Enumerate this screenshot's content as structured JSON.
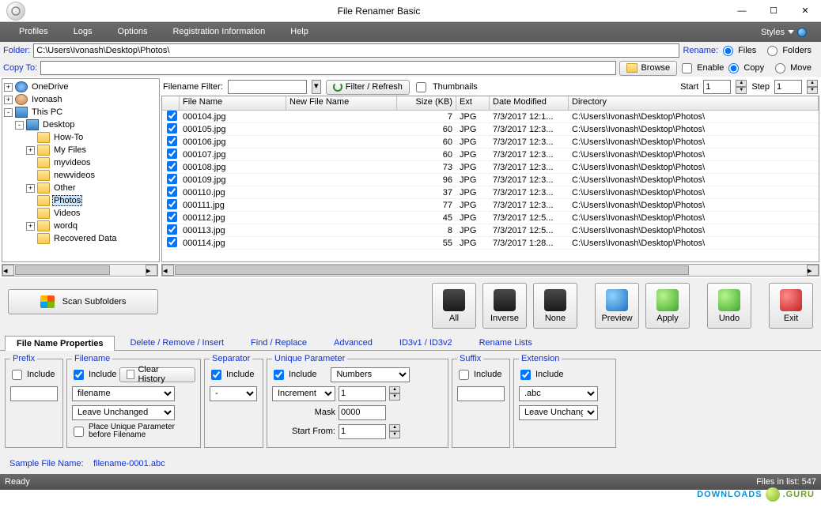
{
  "window": {
    "title": "File Renamer Basic"
  },
  "menu": {
    "items": [
      "Profiles",
      "Logs",
      "Options",
      "Registration Information",
      "Help"
    ],
    "styles": "Styles"
  },
  "toprow": {
    "folder_label": "Folder:",
    "folder_path": "C:\\Users\\Ivonash\\Desktop\\Photos\\",
    "rename_label": "Rename:",
    "files_label": "Files",
    "folders_label": "Folders"
  },
  "copyrow": {
    "copyto_label": "Copy To:",
    "copyto_path": "",
    "browse": "Browse",
    "enable": "Enable",
    "copy": "Copy",
    "move": "Move"
  },
  "tree": {
    "nodes": [
      {
        "exp": "+",
        "ind": 0,
        "icon": "cloud",
        "label": "OneDrive"
      },
      {
        "exp": "+",
        "ind": 0,
        "icon": "avatar",
        "label": "Ivonash"
      },
      {
        "exp": "-",
        "ind": 0,
        "icon": "pc",
        "label": "This PC"
      },
      {
        "exp": "-",
        "ind": 1,
        "icon": "pc",
        "label": "Desktop"
      },
      {
        "exp": "",
        "ind": 2,
        "icon": "folder",
        "label": "How-To"
      },
      {
        "exp": "+",
        "ind": 2,
        "icon": "folder",
        "label": "My Files"
      },
      {
        "exp": "",
        "ind": 2,
        "icon": "folder",
        "label": "myvideos"
      },
      {
        "exp": "",
        "ind": 2,
        "icon": "folder",
        "label": "newvideos"
      },
      {
        "exp": "+",
        "ind": 2,
        "icon": "folder",
        "label": "Other"
      },
      {
        "exp": "",
        "ind": 2,
        "icon": "folder",
        "label": "Photos",
        "sel": true
      },
      {
        "exp": "",
        "ind": 2,
        "icon": "folder",
        "label": "Videos"
      },
      {
        "exp": "+",
        "ind": 2,
        "icon": "folder",
        "label": "wordq"
      },
      {
        "exp": "",
        "ind": 2,
        "icon": "folder",
        "label": "Recovered Data"
      }
    ]
  },
  "filter": {
    "label": "Filename Filter:",
    "filter_refresh": "Filter / Refresh",
    "thumbnails": "Thumbnails",
    "start_label": "Start",
    "start_value": "1",
    "step_label": "Step",
    "step_value": "1"
  },
  "grid": {
    "headers": [
      "",
      "File Name",
      "New File Name",
      "Size (KB)",
      "Ext",
      "Date Modified",
      "Directory"
    ],
    "rows": [
      {
        "name": "000104.jpg",
        "new": "",
        "size": "7",
        "ext": "JPG",
        "date": "7/3/2017 12:1...",
        "dir": "C:\\Users\\Ivonash\\Desktop\\Photos\\"
      },
      {
        "name": "000105.jpg",
        "new": "",
        "size": "60",
        "ext": "JPG",
        "date": "7/3/2017 12:3...",
        "dir": "C:\\Users\\Ivonash\\Desktop\\Photos\\"
      },
      {
        "name": "000106.jpg",
        "new": "",
        "size": "60",
        "ext": "JPG",
        "date": "7/3/2017 12:3...",
        "dir": "C:\\Users\\Ivonash\\Desktop\\Photos\\"
      },
      {
        "name": "000107.jpg",
        "new": "",
        "size": "60",
        "ext": "JPG",
        "date": "7/3/2017 12:3...",
        "dir": "C:\\Users\\Ivonash\\Desktop\\Photos\\"
      },
      {
        "name": "000108.jpg",
        "new": "",
        "size": "73",
        "ext": "JPG",
        "date": "7/3/2017 12:3...",
        "dir": "C:\\Users\\Ivonash\\Desktop\\Photos\\"
      },
      {
        "name": "000109.jpg",
        "new": "",
        "size": "96",
        "ext": "JPG",
        "date": "7/3/2017 12:3...",
        "dir": "C:\\Users\\Ivonash\\Desktop\\Photos\\"
      },
      {
        "name": "000110.jpg",
        "new": "",
        "size": "37",
        "ext": "JPG",
        "date": "7/3/2017 12:3...",
        "dir": "C:\\Users\\Ivonash\\Desktop\\Photos\\"
      },
      {
        "name": "000111.jpg",
        "new": "",
        "size": "77",
        "ext": "JPG",
        "date": "7/3/2017 12:3...",
        "dir": "C:\\Users\\Ivonash\\Desktop\\Photos\\"
      },
      {
        "name": "000112.jpg",
        "new": "",
        "size": "45",
        "ext": "JPG",
        "date": "7/3/2017 12:5...",
        "dir": "C:\\Users\\Ivonash\\Desktop\\Photos\\"
      },
      {
        "name": "000113.jpg",
        "new": "",
        "size": "8",
        "ext": "JPG",
        "date": "7/3/2017 12:5...",
        "dir": "C:\\Users\\Ivonash\\Desktop\\Photos\\"
      },
      {
        "name": "000114.jpg",
        "new": "",
        "size": "55",
        "ext": "JPG",
        "date": "7/3/2017 1:28...",
        "dir": "C:\\Users\\Ivonash\\Desktop\\Photos\\"
      }
    ]
  },
  "actions": {
    "scan": "Scan Subfolders",
    "all": "All",
    "inverse": "Inverse",
    "none": "None",
    "preview": "Preview",
    "apply": "Apply",
    "undo": "Undo",
    "exit": "Exit"
  },
  "tabs": [
    "File Name Properties",
    "Delete / Remove / Insert",
    "Find / Replace",
    "Advanced",
    "ID3v1 / ID3v2",
    "Rename Lists"
  ],
  "props": {
    "prefix": {
      "legend": "Prefix",
      "include": "Include"
    },
    "filename": {
      "legend": "Filename",
      "include": "Include",
      "clear": "Clear History",
      "value": "filename",
      "case": "Leave Unchanged",
      "place": "Place Unique Parameter before Filename"
    },
    "separator": {
      "legend": "Separator",
      "include": "Include",
      "value": "-"
    },
    "unique": {
      "legend": "Unique Parameter",
      "include": "Include",
      "type": "Numbers",
      "mode": "Increment",
      "mode_val": "1",
      "mask_label": "Mask",
      "mask_val": "0000",
      "start_label": "Start From:",
      "start_val": "1"
    },
    "suffix": {
      "legend": "Suffix",
      "include": "Include"
    },
    "extension": {
      "legend": "Extension",
      "include": "Include",
      "value": ".abc",
      "case": "Leave Unchanged"
    }
  },
  "sample": {
    "label": "Sample File Name:",
    "value": "filename-0001.abc"
  },
  "status": {
    "ready": "Ready",
    "count_label": "Files in list:",
    "count": "547"
  },
  "watermark": {
    "text1": "DOWNLOADS",
    "text2": ".GURU"
  }
}
